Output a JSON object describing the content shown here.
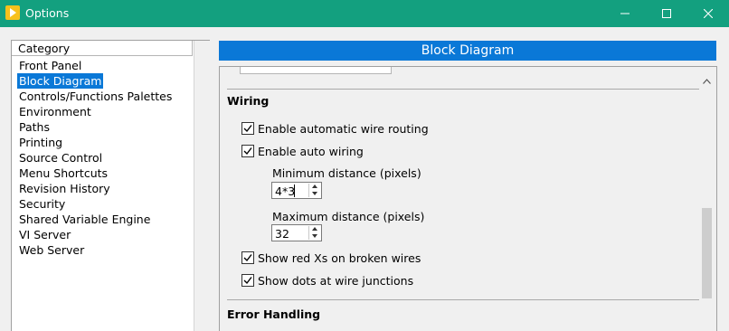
{
  "window": {
    "title": "Options",
    "accent_color": "#13a07f",
    "icon": "labview-app-icon"
  },
  "category_panel": {
    "header": "Category",
    "items": [
      {
        "label": "Front Panel",
        "selected": false
      },
      {
        "label": "Block Diagram",
        "selected": true
      },
      {
        "label": "Controls/Functions Palettes",
        "selected": false
      },
      {
        "label": "Environment",
        "selected": false
      },
      {
        "label": "Paths",
        "selected": false
      },
      {
        "label": "Printing",
        "selected": false
      },
      {
        "label": "Source Control",
        "selected": false
      },
      {
        "label": "Menu Shortcuts",
        "selected": false
      },
      {
        "label": "Revision History",
        "selected": false
      },
      {
        "label": "Security",
        "selected": false
      },
      {
        "label": "Shared Variable Engine",
        "selected": false
      },
      {
        "label": "VI Server",
        "selected": false
      },
      {
        "label": "Web Server",
        "selected": false
      }
    ],
    "selection_color": "#0a78d7"
  },
  "page": {
    "header": "Block Diagram",
    "wiring": {
      "title": "Wiring",
      "auto_routing": {
        "label": "Enable automatic wire routing",
        "checked": true
      },
      "auto_wiring": {
        "label": "Enable auto wiring",
        "checked": true
      },
      "min_distance": {
        "label": "Minimum distance (pixels)",
        "value": "4*3"
      },
      "max_distance": {
        "label": "Maximum distance (pixels)",
        "value": "32"
      },
      "red_xs": {
        "label": "Show red Xs on broken wires",
        "checked": true
      },
      "dots": {
        "label": "Show dots at wire junctions",
        "checked": true
      }
    },
    "error_handling": {
      "title": "Error Handling"
    }
  }
}
